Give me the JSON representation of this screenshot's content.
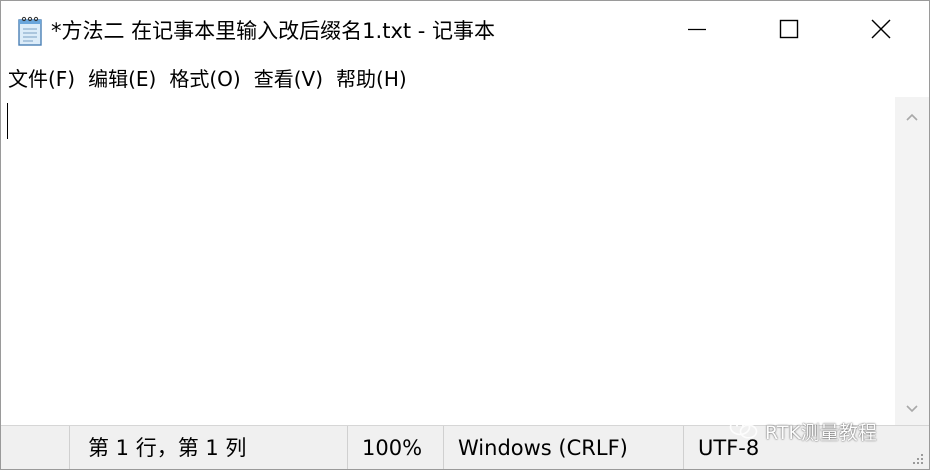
{
  "window": {
    "title": "*方法二 在记事本里输入改后缀名1.txt - 记事本"
  },
  "menu": {
    "items": [
      "文件(F)",
      "编辑(E)",
      "格式(O)",
      "查看(V)",
      "帮助(H)"
    ]
  },
  "editor": {
    "content": ""
  },
  "statusbar": {
    "position": "第 1 行，第 1 列",
    "zoom": "100%",
    "line_ending": "Windows (CRLF)",
    "encoding": "UTF-8"
  },
  "watermark": {
    "text": "RTK测量教程"
  },
  "icons": {
    "app": "notepad-icon",
    "minimize": "minimize-icon",
    "maximize": "maximize-icon",
    "close": "close-icon",
    "scroll_up": "chevron-up-icon",
    "scroll_down": "chevron-down-icon",
    "watermark": "wechat-icon"
  },
  "colors": {
    "statusbar_bg": "#f0f0f0",
    "scrollbar_bg": "#f3f3f3",
    "window_bg": "#ffffff"
  }
}
